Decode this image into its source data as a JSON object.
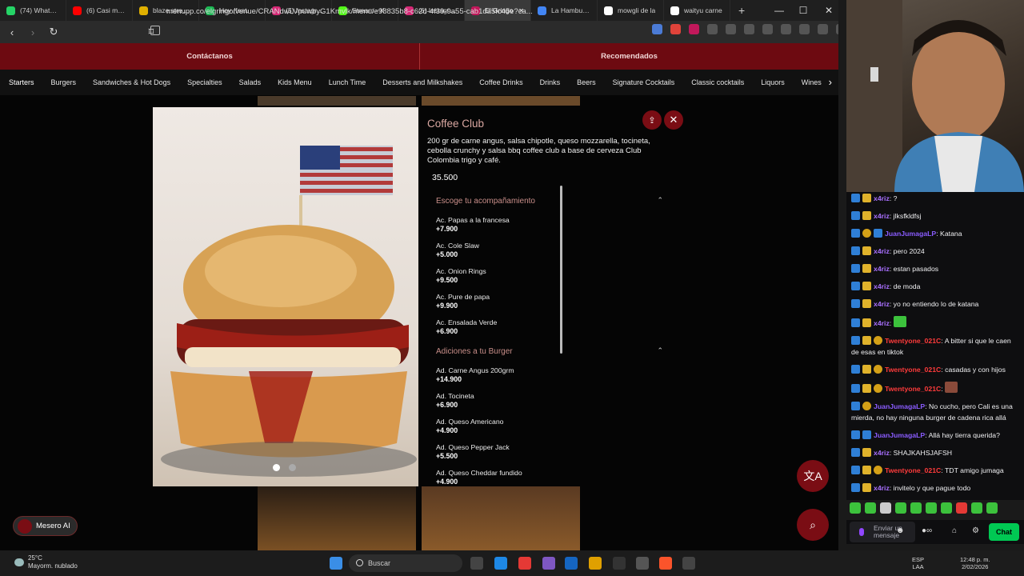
{
  "browser": {
    "tabs": [
      {
        "label": "(74) WhatsApp",
        "color": "#25d366",
        "active": false
      },
      {
        "label": "(6) Casi muero",
        "color": "#ff0000",
        "active": false
      },
      {
        "label": "blaze.stream/",
        "color": "#e0b000",
        "active": false
      },
      {
        "label": "Hoy (feat.",
        "color": "#1db954",
        "active": false
      },
      {
        "label": "(5) Instagram",
        "color": "#d62976",
        "active": false
      },
      {
        "label": "Stream - K",
        "color": "#53fc18",
        "active": false
      },
      {
        "label": "(6) Instagram",
        "color": "#d62976",
        "active": false
      },
      {
        "label": "El Gringo",
        "color": "#c2185b",
        "active": true
      },
      {
        "label": "La Hamburgu",
        "color": "#4285f4",
        "active": false
      },
      {
        "label": "mowgli de la",
        "color": "#ffffff",
        "active": false
      },
      {
        "label": "waityu carne",
        "color": "#ffffff",
        "active": false
      }
    ],
    "new_tab": "+",
    "url": "menupp.co/elgringo/venue/CRANdwLVpuwbyG1Kmvlk/menu/e98835b8-c62d-4f39-9a55-cab1da5fc45e?ca..."
  },
  "page": {
    "top_nav": {
      "left": "Contáctanos",
      "right": "Recomendados"
    },
    "categories": [
      "Starters",
      "Burgers",
      "Sandwiches & Hot Dogs",
      "Specialties",
      "Salads",
      "Kids Menu",
      "Lunch Time",
      "Desserts and Milkshakes",
      "Coffee Drinks",
      "Drinks",
      "Beers",
      "Signature Cocktails",
      "Classic cocktails",
      "Liquors",
      "Wines"
    ],
    "active_category": "Starters",
    "mesero_label": "Mesero AI"
  },
  "product": {
    "title": "Coffee Club",
    "description": "200 gr de carne angus, salsa chipotle, queso mozzarella, tocineta, cebolla crunchy y salsa bbq coffee club a base de cerveza Club Colombia trigo y café.",
    "price": "35.500",
    "sections": [
      {
        "title": "Escoge tu acompañamiento",
        "options": [
          {
            "name": "Ac. Papas a la francesa",
            "price": "+7.900"
          },
          {
            "name": "Ac. Cole Slaw",
            "price": "+5.000"
          },
          {
            "name": "Ac. Onion Rings",
            "price": "+9.500"
          },
          {
            "name": "Ac. Pure de papa",
            "price": "+9.900"
          },
          {
            "name": "Ac. Ensalada Verde",
            "price": "+6.900"
          }
        ]
      },
      {
        "title": "Adiciones a tu Burger",
        "options": [
          {
            "name": "Ad. Carne Angus 200grm",
            "price": "+14.900"
          },
          {
            "name": "Ad. Tocineta",
            "price": "+6.900"
          },
          {
            "name": "Ad. Queso Americano",
            "price": "+4.900"
          },
          {
            "name": "Ad. Queso Pepper Jack",
            "price": "+5.500"
          },
          {
            "name": "Ad. Queso Cheddar fundido",
            "price": "+4.900"
          }
        ]
      }
    ]
  },
  "chat": {
    "messages": [
      {
        "user": "x4riz",
        "color": "#a970ff",
        "text": "?",
        "badges": [
          "b1",
          "b3"
        ]
      },
      {
        "user": "x4riz",
        "color": "#a970ff",
        "text": "jlksfkldfsj",
        "badges": [
          "b1",
          "b3"
        ]
      },
      {
        "user": "JuanJumagaLP",
        "color": "#8a5cff",
        "text": "Katana",
        "badges": [
          "b1",
          "b2",
          "b1"
        ]
      },
      {
        "user": "x4riz",
        "color": "#a970ff",
        "text": "pero 2024",
        "badges": [
          "b1",
          "b3"
        ]
      },
      {
        "user": "x4riz",
        "color": "#a970ff",
        "text": "estan pasados",
        "badges": [
          "b1",
          "b3"
        ]
      },
      {
        "user": "x4riz",
        "color": "#a970ff",
        "text": "de moda",
        "badges": [
          "b1",
          "b3"
        ]
      },
      {
        "user": "x4riz",
        "color": "#a970ff",
        "text": "yo no entiendo lo de katana",
        "badges": [
          "b1",
          "b3"
        ]
      },
      {
        "user": "x4riz",
        "color": "#a970ff",
        "text": "",
        "badges": [
          "b1",
          "b3"
        ]
      },
      {
        "user": "Twentyone_021C",
        "color": "#ff3b3b",
        "text": "A bitter si que le caen de esas en tiktok",
        "badges": [
          "b1",
          "b3",
          "b2"
        ]
      },
      {
        "user": "Twentyone_021C",
        "color": "#ff3b3b",
        "text": "casadas y con hijos",
        "badges": [
          "b1",
          "b3",
          "b2"
        ]
      },
      {
        "user": "Twentyone_021C",
        "color": "#ff3b3b",
        "text": "",
        "badges": [
          "b1",
          "b3",
          "b2"
        ]
      },
      {
        "user": "JuanJumagaLP",
        "color": "#8a5cff",
        "text": "No cucho, pero Cali es una mierda, no hay ninguna burger de cadena rica allá",
        "badges": [
          "b1",
          "b2"
        ]
      },
      {
        "user": "JuanJumagaLP",
        "color": "#8a5cff",
        "text": "Allá hay tierra querida?",
        "badges": [
          "b1",
          "b1"
        ]
      },
      {
        "user": "x4riz",
        "color": "#a970ff",
        "text": "SHAJKAHSJAFSH",
        "badges": [
          "b1",
          "b3"
        ]
      },
      {
        "user": "Twentyone_021C",
        "color": "#ff3b3b",
        "text": "TDT amigo jumaga",
        "badges": [
          "b1",
          "b3",
          "b2"
        ]
      },
      {
        "user": "x4riz",
        "color": "#a970ff",
        "text": "invitelo y que pague todo",
        "badges": [
          "b1",
          "b3"
        ]
      }
    ],
    "input_placeholder": "Enviar un mensaje",
    "chat_button": "Chat"
  },
  "taskbar": {
    "weather_temp": "25°C",
    "weather_desc": "Mayorm. nublado",
    "search_placeholder": "Buscar",
    "lang_top": "ESP",
    "lang_bottom": "LAA",
    "time": "12:48 p. m.",
    "date": "2/02/2026"
  }
}
